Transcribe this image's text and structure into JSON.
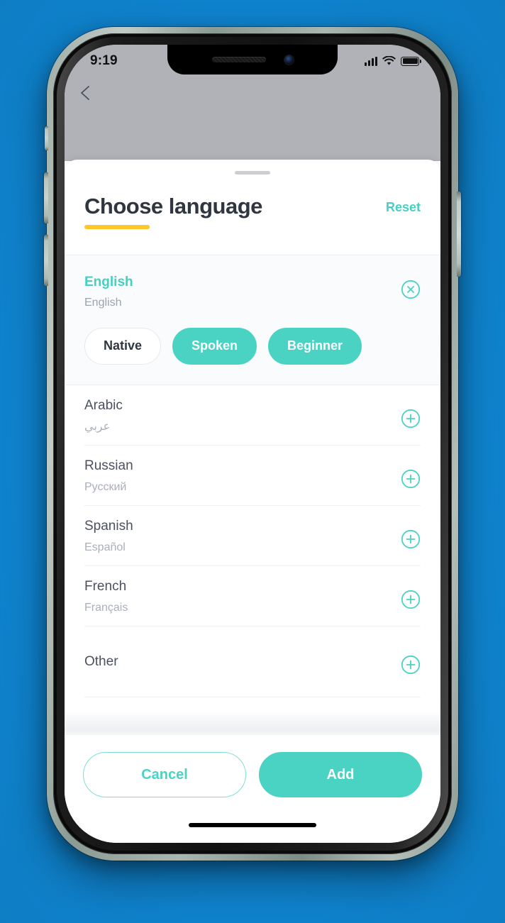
{
  "status_bar": {
    "time": "9:19",
    "signal_icon": "cellular-signal-icon",
    "wifi_icon": "wifi-icon",
    "battery_icon": "battery-icon"
  },
  "nav": {
    "back_icon": "back-chevron-icon"
  },
  "sheet": {
    "grabber": "sheet-drag-handle",
    "title": "Choose language",
    "reset_label": "Reset",
    "accent_underline_color": "#ffc72c",
    "accent_color": "#4ad3c3",
    "title_color": "#2f3640"
  },
  "selected_language": {
    "name": "English",
    "native_name": "English",
    "remove_icon": "circle-x-icon",
    "levels": [
      {
        "label": "Native",
        "selected": false
      },
      {
        "label": "Spoken",
        "selected": true
      },
      {
        "label": "Beginner",
        "selected": true
      }
    ]
  },
  "language_list": [
    {
      "name": "Arabic",
      "native_name": "عربي",
      "add_icon": "circle-plus-icon"
    },
    {
      "name": "Russian",
      "native_name": "Русский",
      "add_icon": "circle-plus-icon"
    },
    {
      "name": "Spanish",
      "native_name": "Español",
      "add_icon": "circle-plus-icon"
    },
    {
      "name": "French",
      "native_name": "Français",
      "add_icon": "circle-plus-icon"
    },
    {
      "name": "Other",
      "native_name": "",
      "add_icon": "circle-plus-icon"
    }
  ],
  "footer": {
    "cancel_label": "Cancel",
    "add_label": "Add"
  }
}
